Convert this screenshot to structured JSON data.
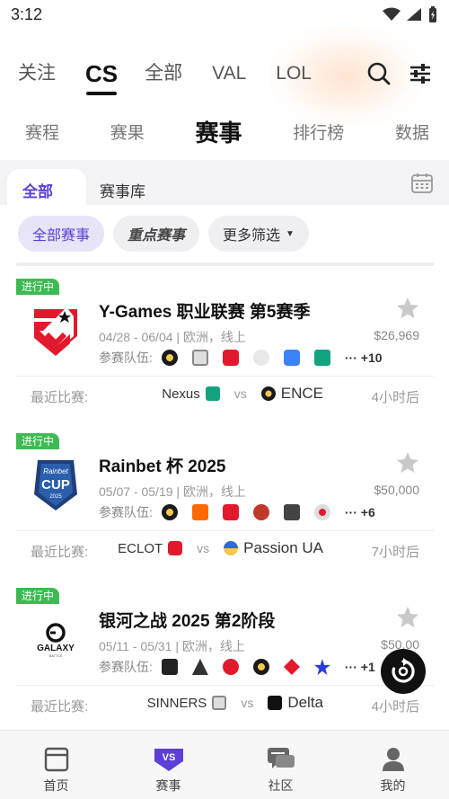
{
  "status": {
    "time": "3:12"
  },
  "game_tabs": [
    {
      "label": "关注",
      "active": false
    },
    {
      "label": "CS",
      "active": true
    },
    {
      "label": "全部",
      "active": false
    },
    {
      "label": "VAL",
      "active": false
    },
    {
      "label": "LOL",
      "active": false
    }
  ],
  "sub_tabs": [
    {
      "label": "赛程",
      "active": false
    },
    {
      "label": "赛果",
      "active": false
    },
    {
      "label": "赛事",
      "active": true
    },
    {
      "label": "排行榜",
      "active": false
    },
    {
      "label": "数据",
      "active": false
    }
  ],
  "segments": {
    "all": "全部",
    "library": "赛事库"
  },
  "chips": {
    "all": "全部赛事",
    "key": "重点赛事",
    "more": "更多筛选"
  },
  "events": [
    {
      "badge": "进行中",
      "title": "Y-Games 职业联赛 第5赛季",
      "dates": "04/28 - 06/04 | 欧洲，线上",
      "prize": "$26,969",
      "teams_label": "参赛队伍:",
      "more_count": "··· +10",
      "recent_label": "最近比赛:",
      "team_a": "Nexus",
      "vs": "vs",
      "team_b": "ENCE",
      "ago": "4小时后"
    },
    {
      "badge": "进行中",
      "title": "Rainbet 杯 2025",
      "dates": "05/07 - 05/19 | 欧洲，线上",
      "prize": "$50,000",
      "teams_label": "参赛队伍:",
      "more_count": "··· +6",
      "recent_label": "最近比赛:",
      "team_a": "ECLOT",
      "vs": "vs",
      "team_b": "Passion UA",
      "ago": "7小时后",
      "logo_text": {
        "top": "Rainbet",
        "main": "CUP",
        "year": "2025"
      }
    },
    {
      "badge": "进行中",
      "title": "银河之战 2025 第2阶段",
      "dates": "05/11 - 05/31 | 欧洲，线上",
      "prize": "$50,00",
      "teams_label": "参赛队伍:",
      "more_count": "··· +1",
      "recent_label": "最近比赛:",
      "team_a": "SINNERS",
      "vs": "vs",
      "team_b": "Delta",
      "ago": "4小时后",
      "logo_text": {
        "main": "GALAXY",
        "sub": "BATTLE"
      }
    }
  ],
  "bottom_nav": [
    {
      "label": "首页",
      "icon": "home-icon"
    },
    {
      "label": "赛事",
      "icon": "vs-icon",
      "badge": "VS"
    },
    {
      "label": "社区",
      "icon": "chat-icon"
    },
    {
      "label": "我的",
      "icon": "user-icon"
    }
  ],
  "colors": {
    "accent": "#5b3fd6",
    "live_badge": "#3dbb52",
    "chip_active_bg": "#e7e4f8"
  }
}
